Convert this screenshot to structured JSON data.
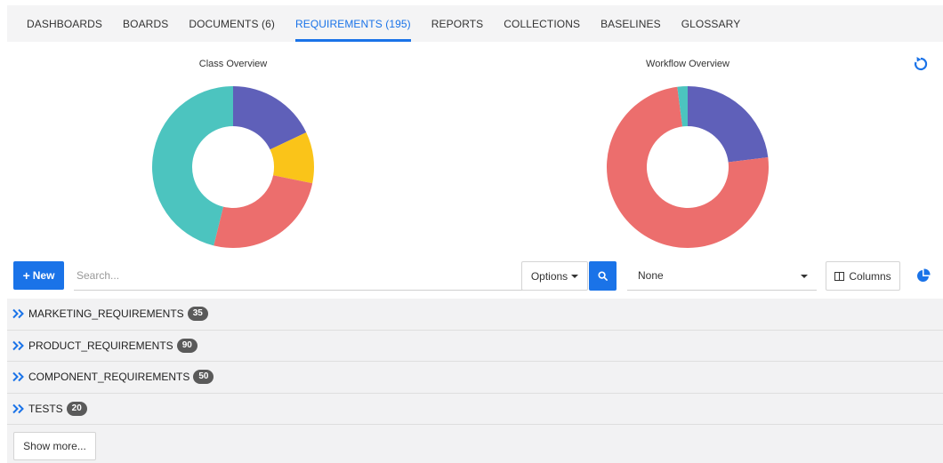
{
  "nav": {
    "tabs": [
      {
        "label": "DASHBOARDS",
        "active": false
      },
      {
        "label": "BOARDS",
        "active": false
      },
      {
        "label": "DOCUMENTS (6)",
        "active": false
      },
      {
        "label": "REQUIREMENTS (195)",
        "active": true
      },
      {
        "label": "REPORTS",
        "active": false
      },
      {
        "label": "COLLECTIONS",
        "active": false
      },
      {
        "label": "BASELINES",
        "active": false
      },
      {
        "label": "GLOSSARY",
        "active": false
      }
    ]
  },
  "overview": {
    "refresh_icon": "refresh-icon"
  },
  "chart_data": [
    {
      "type": "pie",
      "title": "Class Overview",
      "donut": true,
      "slices": [
        {
          "value": 35,
          "color": "#5f60b9"
        },
        {
          "value": 20,
          "color": "#fac419"
        },
        {
          "value": 50,
          "color": "#ec6e6d"
        },
        {
          "value": 90,
          "color": "#4cc4bf"
        }
      ]
    },
    {
      "type": "pie",
      "title": "Workflow Overview",
      "donut": true,
      "slices": [
        {
          "value": 45,
          "color": "#5f60b9"
        },
        {
          "value": 146,
          "color": "#ec6e6d"
        },
        {
          "value": 4,
          "color": "#4cc4bf"
        }
      ]
    }
  ],
  "toolbar": {
    "new_label": "New",
    "search_placeholder": "Search...",
    "options_label": "Options",
    "group_by_value": "None",
    "columns_label": "Columns",
    "chart_toggle_icon": "pie-chart-icon"
  },
  "groups": [
    {
      "name": "MARKETING_REQUIREMENTS",
      "count": "35"
    },
    {
      "name": "PRODUCT_REQUIREMENTS",
      "count": "90"
    },
    {
      "name": "COMPONENT_REQUIREMENTS",
      "count": "50"
    },
    {
      "name": "TESTS",
      "count": "20"
    }
  ],
  "show_more_label": "Show more...",
  "colors": {
    "accent": "#1a73e8",
    "badge": "#5a5a5a",
    "row_bg": "#f2f2f3"
  }
}
